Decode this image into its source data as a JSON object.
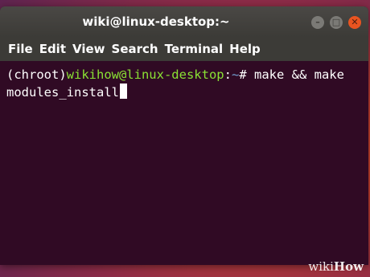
{
  "window": {
    "title": "wiki@linux-desktop:~",
    "controls": {
      "minimize": "–",
      "maximize": "□",
      "close": "✕"
    }
  },
  "menubar": {
    "items": [
      "File",
      "Edit",
      "View",
      "Search",
      "Terminal",
      "Help"
    ]
  },
  "terminal": {
    "chroot": "(chroot)",
    "user_host": "wikihow@linux-desktop",
    "colon": ":",
    "path": "~",
    "symbol": "#",
    "command_line1": " make && make",
    "command_line2": "modules_install"
  },
  "watermark": {
    "prefix": "wiki",
    "suffix": "How"
  },
  "colors": {
    "terminal_bg": "#300a24",
    "prompt_user": "#8ae234",
    "prompt_path": "#729fcf",
    "close_button": "#e95420"
  }
}
